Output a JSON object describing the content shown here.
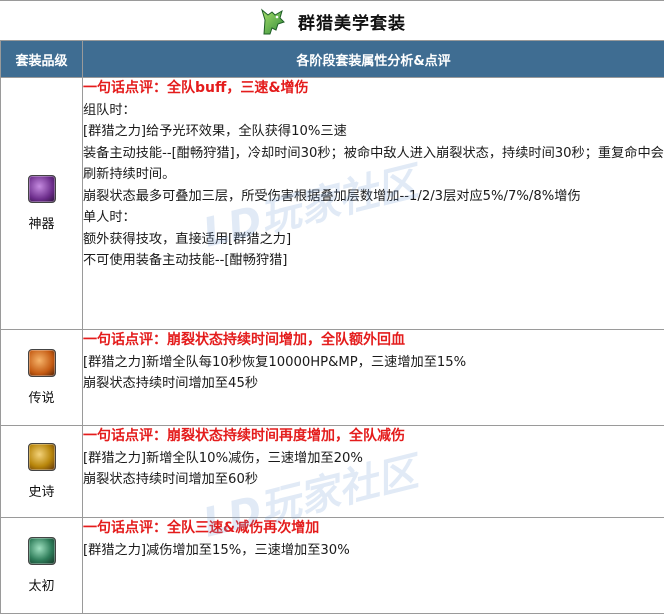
{
  "title": "群猎美学套装",
  "header": {
    "col_grade": "套装品级",
    "col_analysis": "各阶段套装属性分析&点评"
  },
  "rows": [
    {
      "grade": "神器",
      "icon": "purple-gauntlet-icon",
      "icon_color": "#6b2c8a",
      "verdict": "一句话点评：全队buff，三速&增伤",
      "lines": [
        "组队时：",
        "[群猎之力]给予光环效果，全队获得10%三速",
        "装备主动技能--[酣畅狩猎]，冷却时间30秒；被命中敌人进入崩裂状态，持续时间30秒；重复命中会刷新持续时间。",
        "崩裂状态最多可叠加三层，所受伤害根据叠加层数增加--1/2/3层对应5%/7%/8%增伤",
        "单人时：",
        "额外获得技攻，直接适用[群猎之力]",
        "不可使用装备主动技能--[酣畅狩猎]"
      ]
    },
    {
      "grade": "传说",
      "icon": "orange-gauntlet-icon",
      "icon_color": "#c45a12",
      "verdict": "一句话点评：崩裂状态持续时间增加，全队额外回血",
      "lines": [
        "[群猎之力]新增全队每10秒恢复10000HP&MP，三速增加至15%",
        "崩裂状态持续时间增加至45秒"
      ]
    },
    {
      "grade": "史诗",
      "icon": "gold-gauntlet-icon",
      "icon_color": "#b8860b",
      "verdict": "一句话点评：崩裂状态持续时间再度增加，全队减伤",
      "lines": [
        "[群猎之力]新增全队10%减伤，三速增加至20%",
        "崩裂状态持续时间增加至60秒"
      ]
    },
    {
      "grade": "太初",
      "icon": "green-gauntlet-icon",
      "icon_color": "#2f7d5a",
      "verdict": "一句话点评：全队三速&减伤再次增加",
      "lines": [
        "[群猎之力]减伤增加至15%，三速增加至30%"
      ]
    }
  ],
  "watermark": "LD玩家社区"
}
